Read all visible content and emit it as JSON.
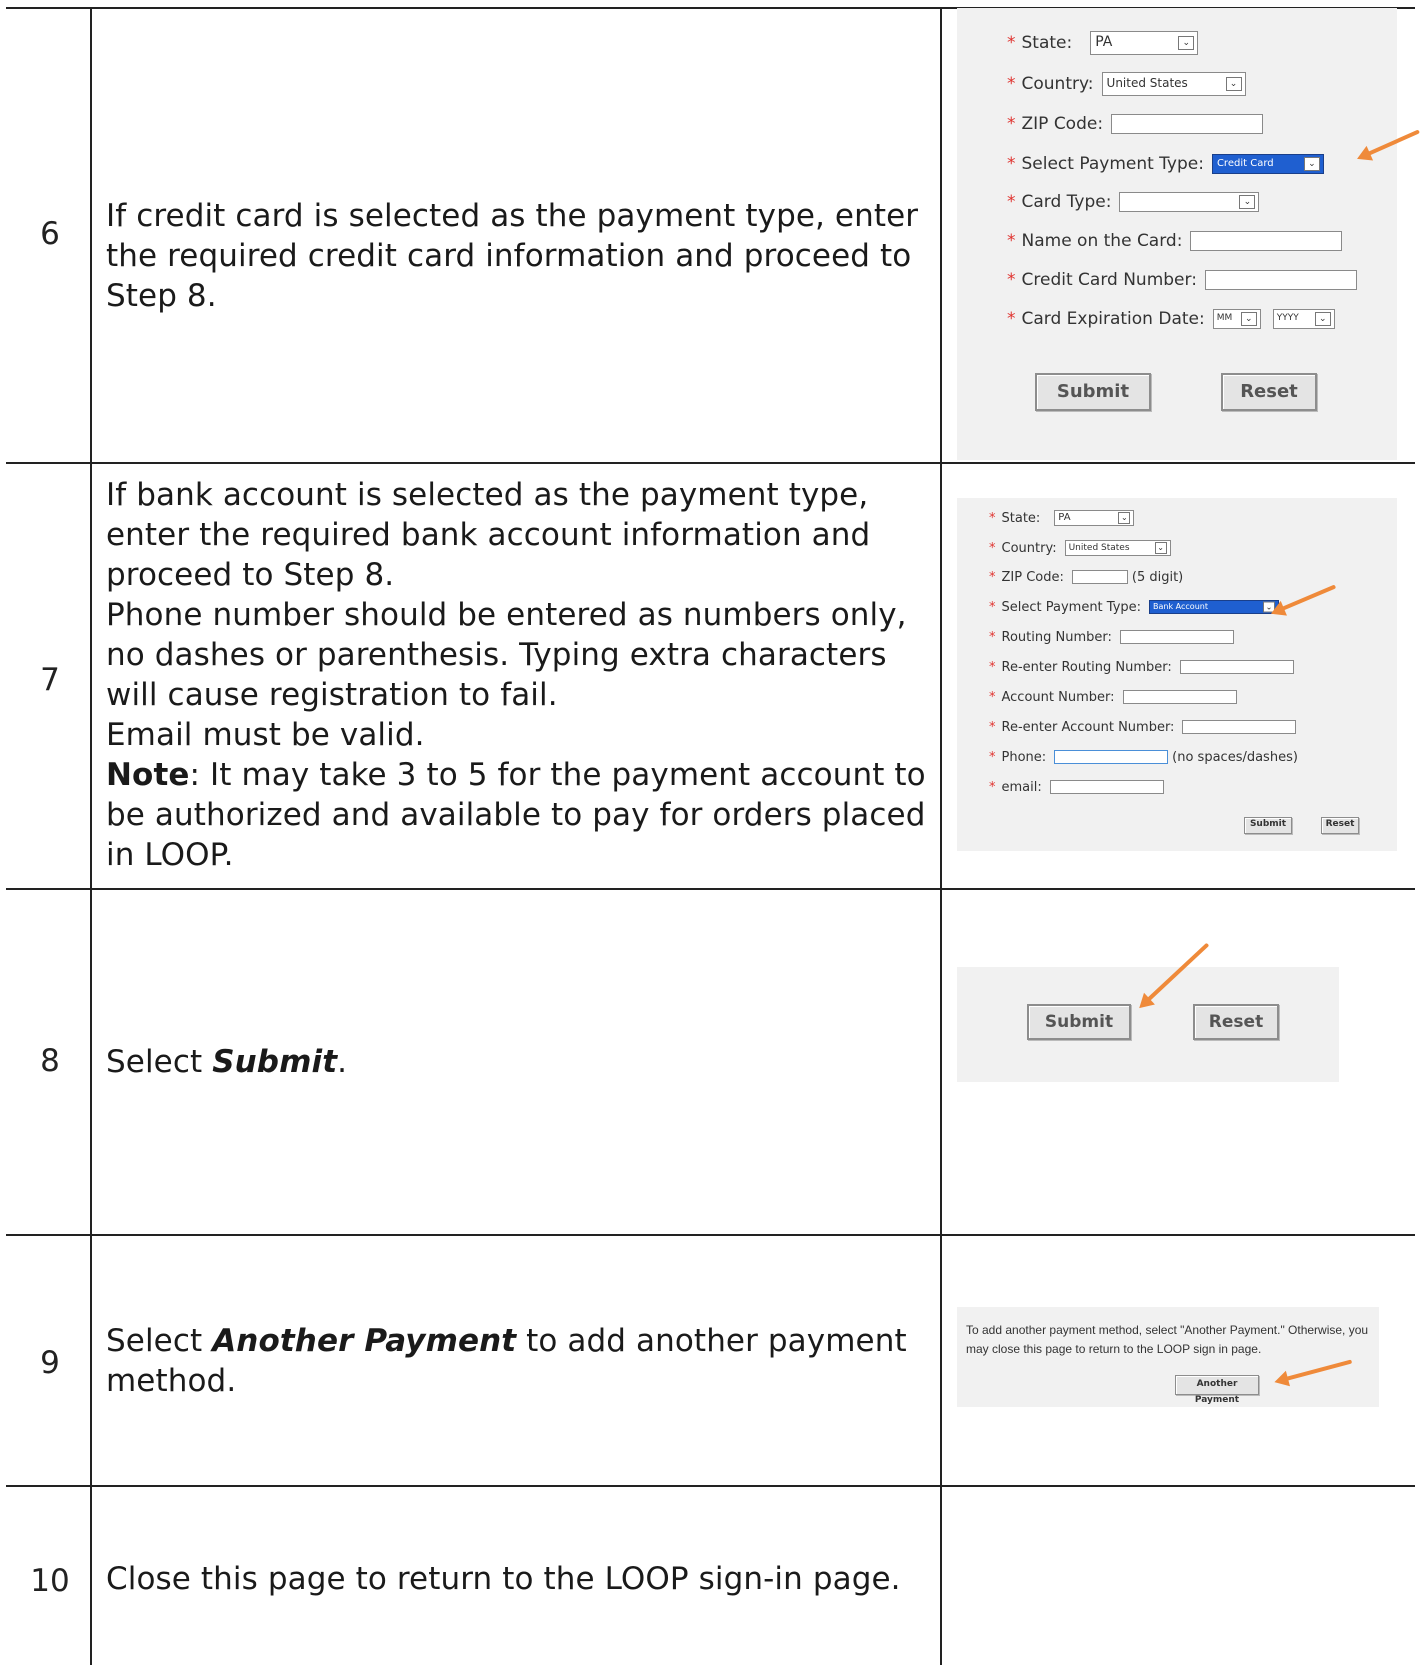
{
  "steps": [
    {
      "num": "6",
      "text": "If credit card is selected as the payment type, enter the required credit card information and proceed to Step 8."
    },
    {
      "num": "7",
      "text1": "If bank account is selected as the payment type, enter the required bank account information and proceed to Step 8.",
      "text2": "Phone number should be entered as numbers only, no dashes or parenthesis. Typing extra characters will cause registration to fail.",
      "text3": "Email must be valid.",
      "note_label": "Note",
      "note_text": ": It may take 3 to 5 for the payment account to be authorized and available to pay for orders placed in LOOP."
    },
    {
      "num": "8",
      "pre": "Select ",
      "emph": "Submit",
      "post": "."
    },
    {
      "num": "9",
      "pre": "Select ",
      "emph": "Another Payment",
      "post": " to add another payment method."
    },
    {
      "num": "10",
      "text": "Close this page to return to the LOOP sign-in page."
    }
  ],
  "credit_form": {
    "asterisk": "*",
    "state_label": "State:",
    "state_value": "PA",
    "country_label": "Country:",
    "country_value": "United States",
    "zip_label": "ZIP Code:",
    "payment_type_label": "Select Payment Type:",
    "payment_type_value": "Credit Card",
    "card_type_label": "Card Type:",
    "name_label": "Name on the Card:",
    "number_label": "Credit Card Number:",
    "expiry_label": "Card Expiration Date:",
    "expiry_month": "MM",
    "expiry_year": "YYYY",
    "submit": "Submit",
    "reset": "Reset"
  },
  "bank_form": {
    "asterisk": "*",
    "state_label": "State:",
    "state_value": "PA",
    "country_label": "Country:",
    "country_value": "United States",
    "zip_label": "ZIP Code:",
    "zip_hint": "(5 digit)",
    "payment_type_label": "Select Payment Type:",
    "payment_type_value": "Bank Account",
    "routing_label": "Routing Number:",
    "routing2_label": "Re-enter Routing Number:",
    "account_label": "Account Number:",
    "account2_label": "Re-enter Account Number:",
    "phone_label": "Phone:",
    "phone_hint": "(no spaces/dashes)",
    "email_label": "email:",
    "submit": "Submit",
    "reset": "Reset"
  },
  "submit_panel": {
    "submit": "Submit",
    "reset": "Reset"
  },
  "another_panel": {
    "message": "To add another payment method, select \"Another Payment.\" Otherwise, you may close this page to return to the LOOP sign in page.",
    "button": "Another Payment"
  },
  "colors": {
    "required": "#e0332f",
    "arrow": "#ef8a3a",
    "highlight": "#1f5fd0"
  }
}
